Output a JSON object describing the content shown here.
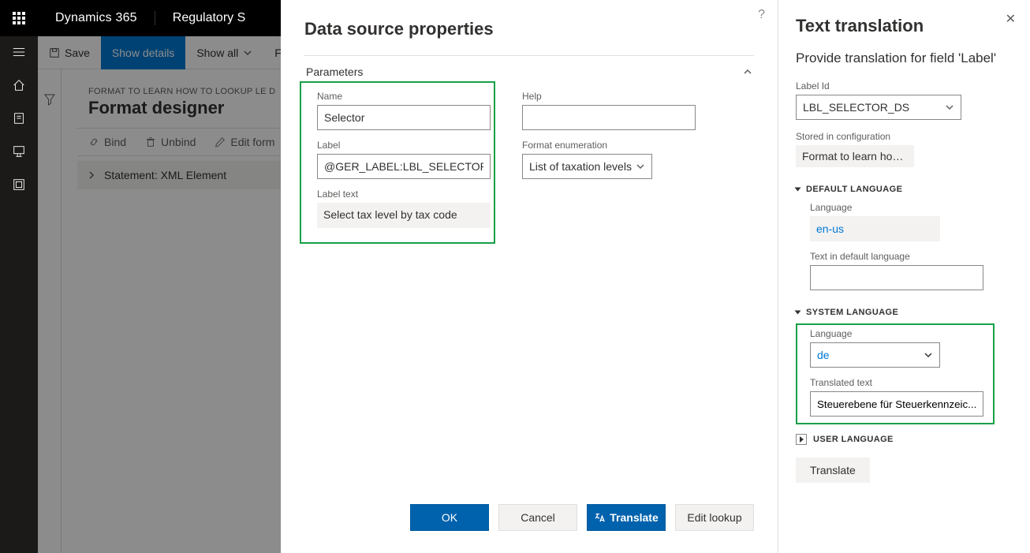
{
  "topbar": {
    "brand1": "Dynamics 365",
    "brand2": "Regulatory S"
  },
  "cmdbar": {
    "save": "Save",
    "show_details": "Show details",
    "show_all": "Show all",
    "fo": "Fo"
  },
  "page": {
    "eyebrow": "FORMAT TO LEARN HOW TO LOOKUP LE D",
    "title": "Format designer",
    "mini": {
      "bind": "Bind",
      "unbind": "Unbind",
      "edit": "Edit form"
    },
    "tree_row": "Statement: XML Element"
  },
  "ds": {
    "title": "Data source properties",
    "section": "Parameters",
    "name_lbl": "Name",
    "name_val": "Selector",
    "label_lbl": "Label",
    "label_val": "@GER_LABEL:LBL_SELECTOR_DS",
    "labeltext_lbl": "Label text",
    "labeltext_val": "Select tax level by tax code",
    "help_lbl": "Help",
    "help_val": "",
    "enum_lbl": "Format enumeration",
    "enum_val": "List of taxation levels",
    "ok": "OK",
    "cancel": "Cancel",
    "translate": "Translate",
    "edit_lookup": "Edit lookup"
  },
  "tt": {
    "title": "Text translation",
    "subtitle": "Provide translation for field 'Label'",
    "labelid_lbl": "Label Id",
    "labelid_val": "LBL_SELECTOR_DS",
    "stored_lbl": "Stored in configuration",
    "stored_val": "Format to learn how t...",
    "grp_default": "DEFAULT LANGUAGE",
    "def_lang_lbl": "Language",
    "def_lang_val": "en-us",
    "def_text_lbl": "Text in default language",
    "def_text_val": "",
    "grp_system": "SYSTEM LANGUAGE",
    "sys_lang_lbl": "Language",
    "sys_lang_val": "de",
    "sys_text_lbl": "Translated text",
    "sys_text_val": "Steuerebene für Steuerkennzeic...",
    "grp_user": "USER LANGUAGE",
    "translate_btn": "Translate"
  }
}
